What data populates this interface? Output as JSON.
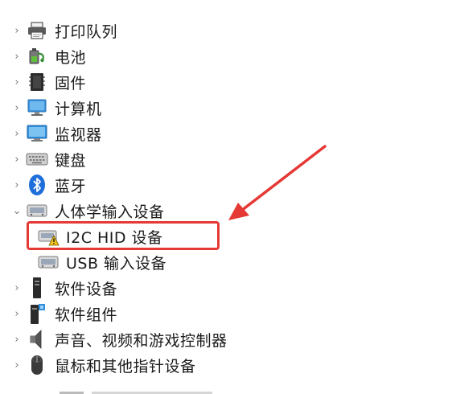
{
  "device_tree": {
    "items": [
      {
        "label": "打印队列",
        "icon": "printer-icon",
        "expanded": false
      },
      {
        "label": "电池",
        "icon": "battery-icon",
        "expanded": false
      },
      {
        "label": "固件",
        "icon": "firmware-icon",
        "expanded": false
      },
      {
        "label": "计算机",
        "icon": "computer-icon",
        "expanded": false
      },
      {
        "label": "监视器",
        "icon": "monitor-icon",
        "expanded": false
      },
      {
        "label": "键盘",
        "icon": "keyboard-icon",
        "expanded": false
      },
      {
        "label": "蓝牙",
        "icon": "bluetooth-icon",
        "expanded": false
      },
      {
        "label": "人体学输入设备",
        "icon": "hid-icon",
        "expanded": true,
        "children": [
          {
            "label": "I2C HID 设备",
            "icon": "hid-warning-icon",
            "status": "warning"
          },
          {
            "label": "USB 输入设备",
            "icon": "hid-device-icon"
          }
        ]
      },
      {
        "label": "软件设备",
        "icon": "software-device-icon",
        "expanded": false
      },
      {
        "label": "软件组件",
        "icon": "software-component-icon",
        "expanded": false
      },
      {
        "label": "声音、视频和游戏控制器",
        "icon": "speaker-icon",
        "expanded": false
      },
      {
        "label": "鼠标和其他指针设备",
        "icon": "mouse-icon",
        "expanded": false
      }
    ]
  },
  "annotation": {
    "highlight_color": "#e53935"
  },
  "colors": {
    "warning": "#f5c518",
    "bluetooth": "#1e6fd9",
    "monitor": "#2f8fdc"
  }
}
